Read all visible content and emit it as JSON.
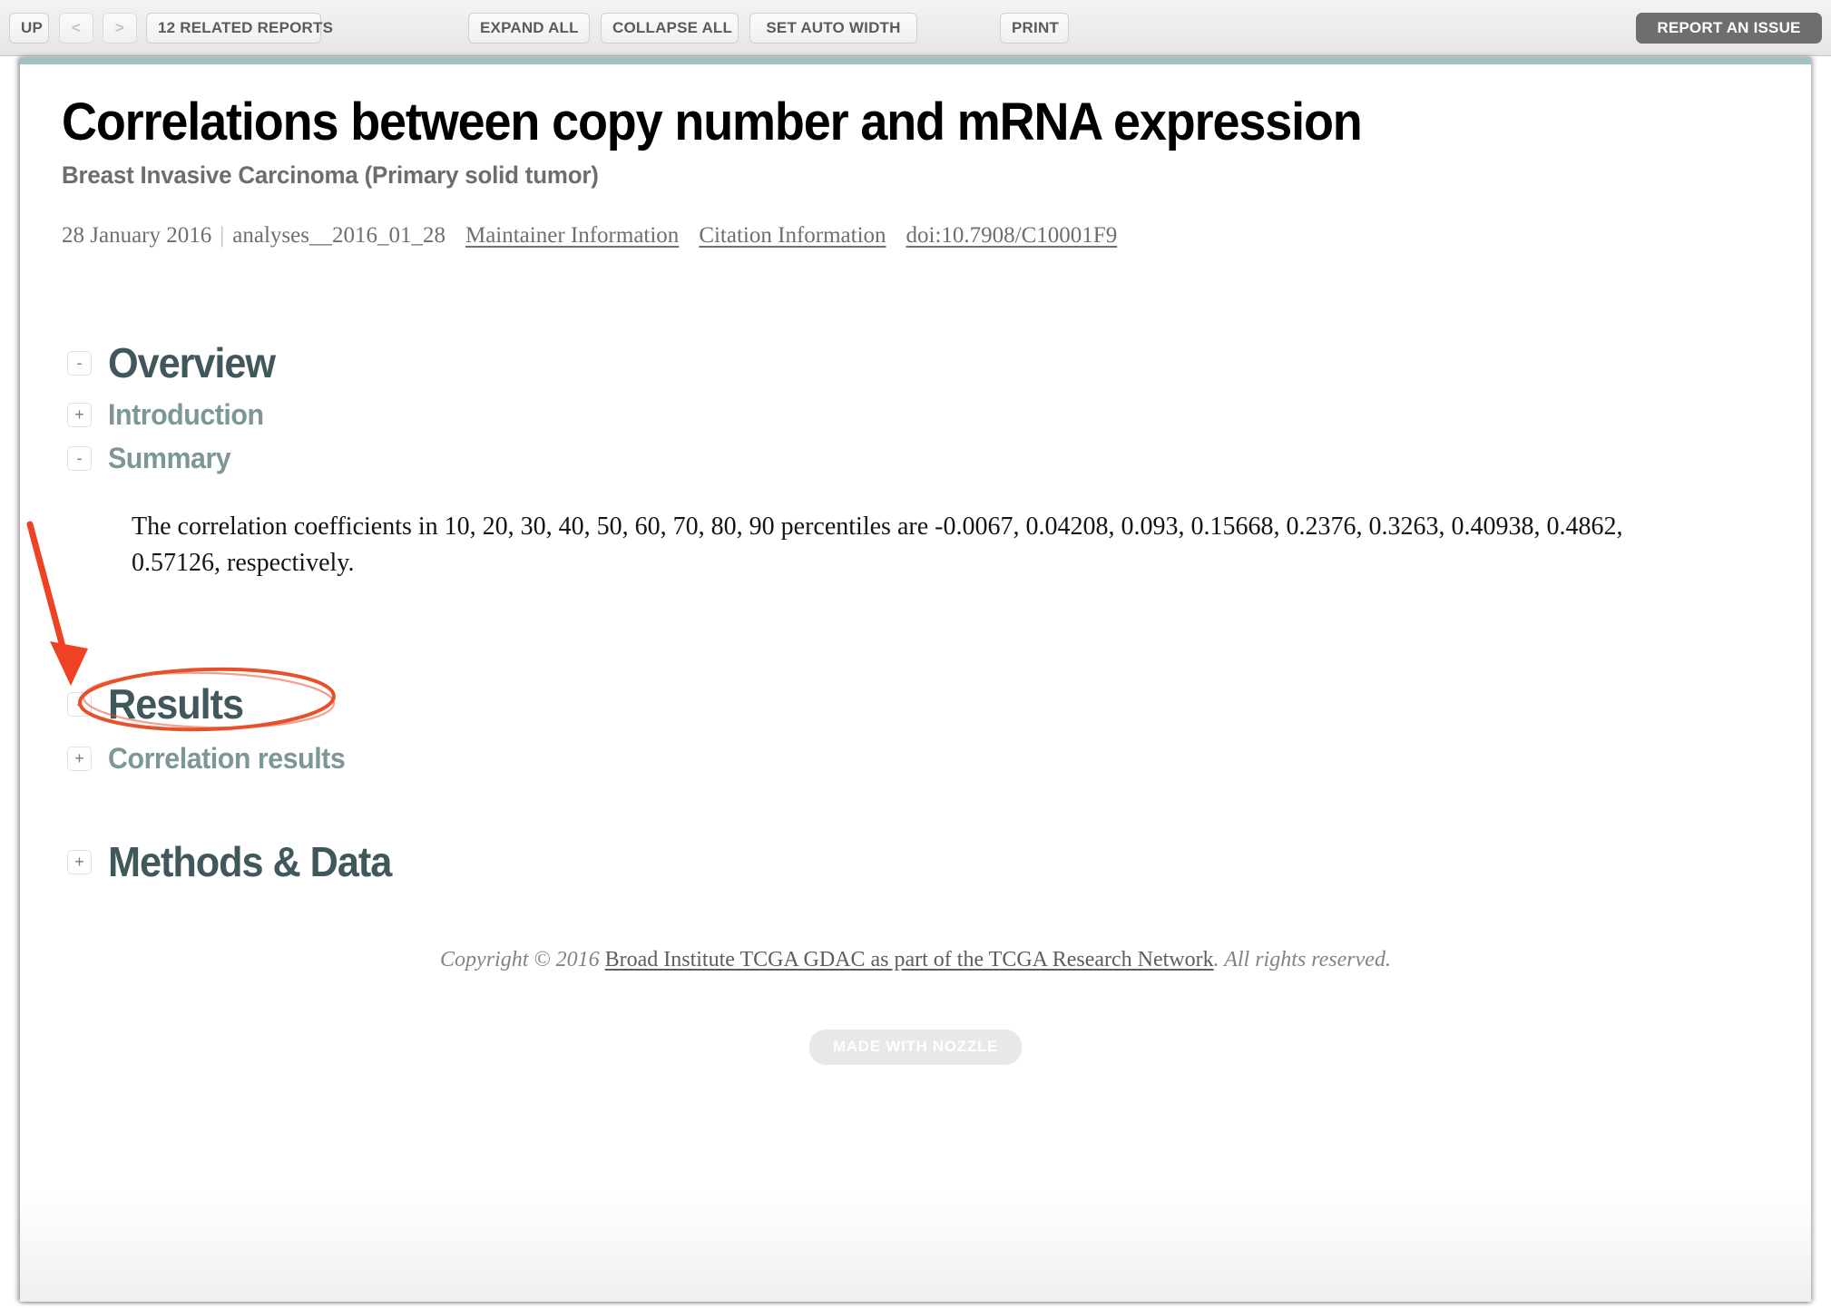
{
  "toolbar": {
    "up_label": "UP",
    "prev_label": "<",
    "next_label": ">",
    "related_reports_label": "12 RELATED REPORTS",
    "expand_all_label": "EXPAND ALL",
    "collapse_all_label": "COLLAPSE ALL",
    "set_auto_width_label": "SET AUTO WIDTH",
    "print_label": "PRINT",
    "report_issue_label": "REPORT AN ISSUE"
  },
  "document": {
    "title": "Correlations between copy number and mRNA expression",
    "subtitle": "Breast Invasive Carcinoma (Primary solid tumor)",
    "meta": {
      "date": "28 January 2016",
      "separator": "|",
      "pipeline": "analyses__2016_01_28",
      "maintainer_link": "Maintainer Information",
      "citation_link": "Citation Information",
      "doi_link": "doi:10.7908/C10001F9"
    }
  },
  "sections": {
    "overview": {
      "toggle": "-",
      "label": "Overview",
      "state": "expanded"
    },
    "introduction": {
      "toggle": "+",
      "label": "Introduction",
      "state": "collapsed"
    },
    "summary": {
      "toggle": "-",
      "label": "Summary",
      "state": "expanded"
    },
    "results": {
      "toggle": "-",
      "label": "Results",
      "state": "expanded"
    },
    "correlation_results": {
      "toggle": "+",
      "label": "Correlation results",
      "state": "collapsed"
    },
    "methods_and_data": {
      "toggle": "+",
      "label": "Methods & Data",
      "state": "collapsed"
    }
  },
  "summary_text": "The correlation coefficients in 10, 20, 30, 40, 50, 60, 70, 80, 90 percentiles are -0.0067, 0.04208, 0.093, 0.15668, 0.2376, 0.3263, 0.40938, 0.4862, 0.57126, respectively.",
  "summary_values": {
    "percentiles": [
      10,
      20,
      30,
      40,
      50,
      60,
      70,
      80,
      90
    ],
    "correlation_coefficients": [
      -0.0067,
      0.04208,
      0.093,
      0.15668,
      0.2376,
      0.3263,
      0.40938,
      0.4862,
      0.57126
    ]
  },
  "footer": {
    "prefix": "Copyright © 2016 ",
    "link": "Broad Institute TCGA GDAC as part of the TCGA Research Network",
    "suffix": ". All rights reserved.",
    "badge_label": "MADE WITH NOZZLE"
  },
  "annotations": {
    "arrow_color": "#ef4123",
    "ellipse_color": "#e8502c",
    "arrow_target": "correlation-results-expand-toggle",
    "ellipse_target": "correlation-results-label"
  },
  "colors": {
    "accent_rule": "#9fc3c2",
    "heading_primary": "#40585b",
    "heading_secondary": "#7d9698",
    "toolbar_dark_button": "#6e6e6e"
  }
}
